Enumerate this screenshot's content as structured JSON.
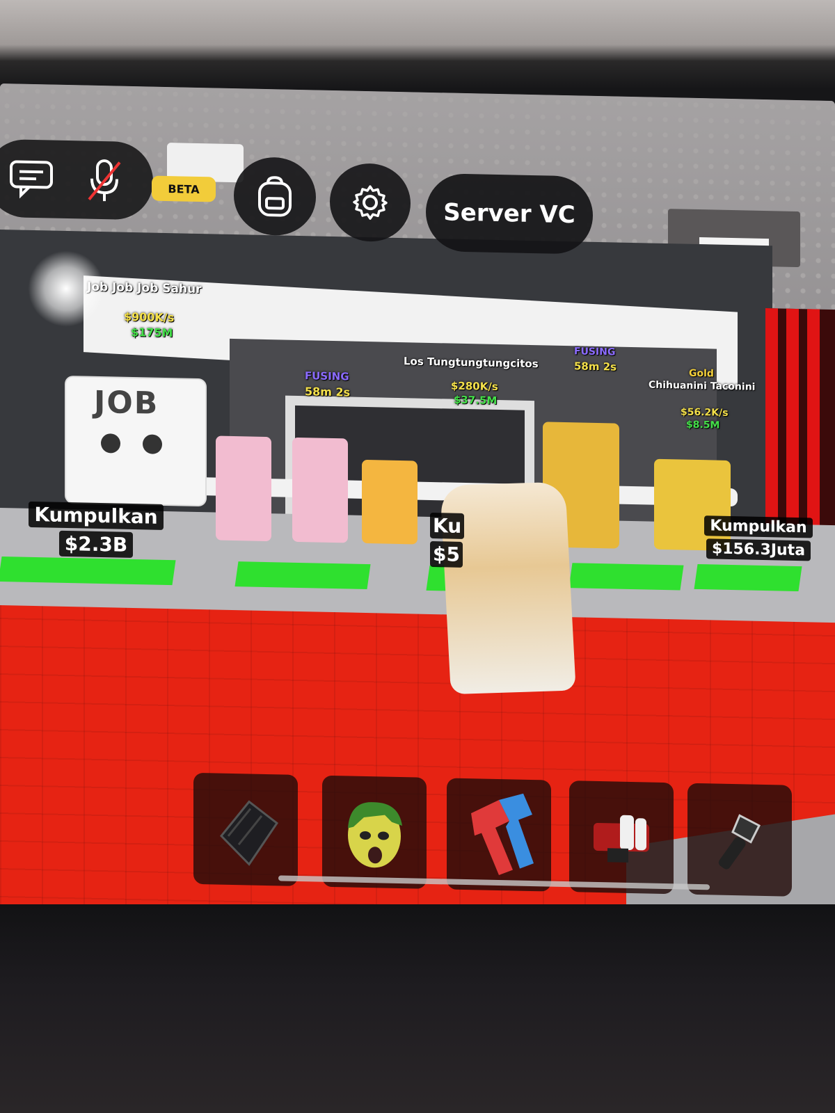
{
  "hud": {
    "chat_icon": "chat-icon",
    "mic_icon": "mic-muted-icon",
    "beta_badge": "BETA",
    "backpack_icon": "backpack-icon",
    "settings_icon": "gear-icon",
    "server_vc_label": "Server VC"
  },
  "world": {
    "job_block_text": "JOB",
    "overheads": [
      {
        "name": "Job Job Job Sahur",
        "rate": "$900K/s",
        "cost": "$175M"
      },
      {
        "status": "FUSING",
        "timer": "58m 2s"
      },
      {
        "name": "Los Tungtungtungcitos",
        "rate": "$280K/s",
        "cost": "$37.5M"
      },
      {
        "status": "FUSING",
        "timer": "58m 2s"
      },
      {
        "rarity": "Gold",
        "name": "Chihuanini Taconini",
        "rate": "$56.2K/s",
        "cost": "$8.5M"
      }
    ],
    "collect_buttons": [
      {
        "label": "Kumpulkan",
        "amount": "$2.3B"
      },
      {
        "label": "Ku",
        "amount": "$5"
      },
      {
        "label": "Kumpulkan",
        "amount": "$156.3Juta"
      }
    ]
  },
  "hotbar": [
    {
      "icon": "black-claw-icon"
    },
    {
      "icon": "green-mask-icon"
    },
    {
      "icon": "red-blue-glove-icon"
    },
    {
      "icon": "red-gadget-icon"
    },
    {
      "icon": "flashlight-icon"
    }
  ],
  "colors": {
    "floor": "#e62313",
    "pad": "#2fe02f",
    "hud": "#141416",
    "beta": "#f2cc3a"
  }
}
